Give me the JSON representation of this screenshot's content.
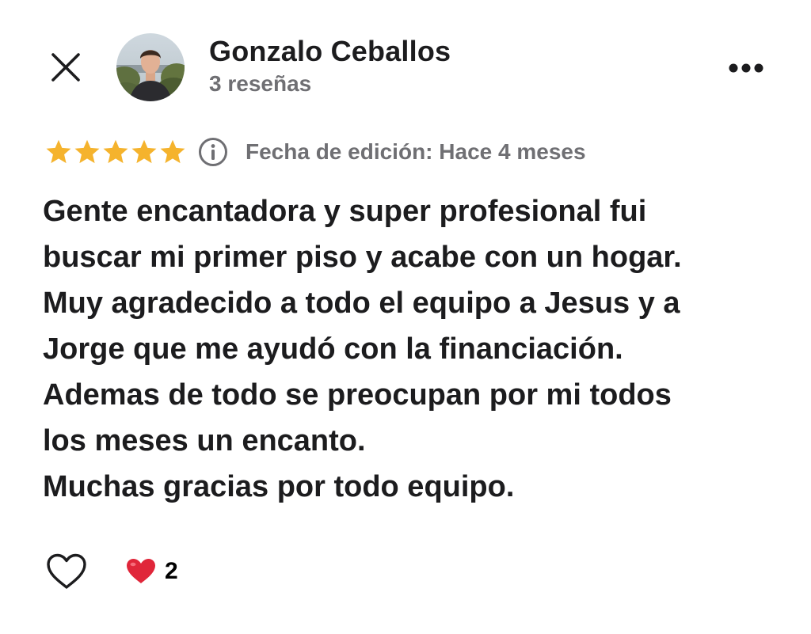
{
  "header": {
    "author_name": "Gonzalo Ceballos",
    "review_count": "3 reseñas",
    "close_icon": "close-icon",
    "more_icon": "more-horizontal-icon"
  },
  "rating": {
    "stars": 5,
    "max_stars": 5,
    "star_color": "#F5B32D",
    "info_icon": "info-icon",
    "edit_date": "Fecha de edición: Hace 4 meses"
  },
  "review": {
    "lines": [
      "Gente encantadora y super profesional fui",
      "buscar mi primer piso y acabe con un hogar.",
      "Muy agradecido a todo el equipo a Jesus y a",
      "Jorge que me ayudó con la financiación.",
      "Ademas de todo se preocupan por mi todos",
      "los meses un encanto.",
      "Muchas gracias por todo equipo."
    ]
  },
  "footer": {
    "like_icon": "heart-outline-icon",
    "reaction_icon": "red-heart-icon",
    "reaction_count": "2",
    "reaction_color": "#E0263A"
  }
}
